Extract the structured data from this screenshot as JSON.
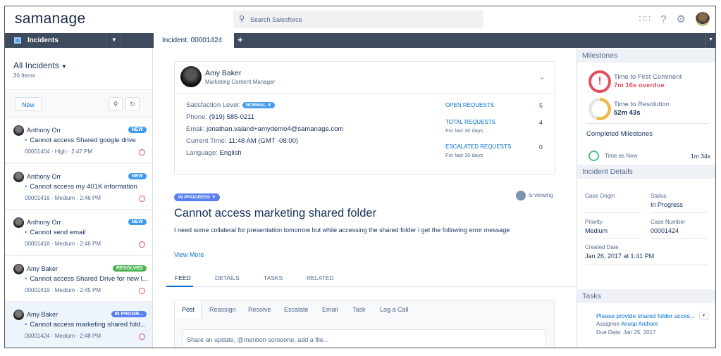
{
  "header": {
    "logo": "samanage",
    "search_placeholder": "Search Salesforce"
  },
  "nav": {
    "app_label": "Incidents",
    "tab_label": "Incident: 00001424",
    "add_tab": "+"
  },
  "list": {
    "title": "All Incidents",
    "count": "30 Items",
    "new_label": "New",
    "items": [
      {
        "name": "Anthony Orr",
        "subject": "Cannot access Shared google drive",
        "meta": "00001404 · High · 2:47 PM",
        "badge": "NEW",
        "badge_color": "#3b9af0"
      },
      {
        "name": "Anthony Orr",
        "subject": "Cannot access my 401K information",
        "meta": "00001416 · Medium · 2:46 PM",
        "badge": "NEW",
        "badge_color": "#3b9af0"
      },
      {
        "name": "Anthony Orr",
        "subject": "Cannot send email",
        "meta": "00001418 · Medium · 2:46 PM",
        "badge": "NEW",
        "badge_color": "#3b9af0"
      },
      {
        "name": "Amy Baker",
        "subject": "Cannot access Shared Drive for new l...",
        "meta": "00001419 · Medium · 2:45 PM",
        "badge": "RESOLVED",
        "badge_color": "#4bb34f"
      },
      {
        "name": "Amy Baker",
        "subject": "Cannot access marketing shared fold...",
        "meta": "00001424 · Medium · 2:48 PM",
        "badge": "IN PROGR...",
        "badge_color": "#5a7ff0"
      }
    ]
  },
  "contact": {
    "name": "Amy Baker",
    "role": "Marketing Content Manager",
    "satisfaction_label": "Satisfaction Level:",
    "satisfaction_value": "NORMAL",
    "phone_label": "Phone:",
    "phone": "(919) 585-0211",
    "email_label": "Email:",
    "email": "jonathan.valand+amydemo4@samanage.com",
    "time_label": "Current Time:",
    "time": "11:48 AM (GMT -08:00)",
    "language_label": "Language:",
    "language": "English",
    "requests": [
      {
        "label": "OPEN REQUESTS",
        "sub": "",
        "value": "5"
      },
      {
        "label": "TOTAL REQUESTS",
        "sub": "For last 30 days",
        "value": "4"
      },
      {
        "label": "ESCALATED REQUESTS",
        "sub": "For last 30 days",
        "value": "0"
      }
    ]
  },
  "incident": {
    "status": "IN PROGRESS",
    "viewing": "is viewing",
    "title": "Cannot access marketing shared folder",
    "description": "I need some collateral for presentation tomorrow but while accessing the shared folder i get the following error message",
    "view_more": "View More"
  },
  "tabs": [
    "FEED",
    "DETAILS",
    "TASKS",
    "RELATED"
  ],
  "publisher": {
    "tabs": [
      "Post",
      "Reassign",
      "Resolve",
      "Escalate",
      "Email",
      "Task",
      "Log a Call"
    ],
    "placeholder": "Share an update, @mention someone, add a file..."
  },
  "milestones": {
    "title": "Milestones",
    "first": {
      "label": "Time to First Comment",
      "value": "7m 16s overdue"
    },
    "resolution": {
      "label": "Time to Resolution",
      "value": "52m 43s",
      "progress": 0.55
    },
    "completed_title": "Completed Milestones",
    "completed": {
      "label": "Time as New",
      "value": "1m 34s"
    }
  },
  "details": {
    "title": "Incident Details",
    "case_origin_label": "Case Origin",
    "case_origin": "",
    "status_label": "Status",
    "status": "In Progress",
    "priority_label": "Priority",
    "priority": "Medium",
    "case_number_label": "Case Number",
    "case_number": "00001424",
    "created_label": "Created Date",
    "created": "Jan 26, 2017 at 1:41 PM"
  },
  "tasks": {
    "title": "Tasks",
    "task": "Please provide shared folder acces...",
    "assignee_label": "Assignee",
    "assignee": "Anoop Anthore",
    "due": "Due Date: Jan 25, 2017"
  },
  "colors": {
    "nav": "#3e4a5e",
    "accent": "#0070d2",
    "overdue": "#e05260",
    "resolution": "#f0b54a",
    "complete": "#4bc08a"
  }
}
